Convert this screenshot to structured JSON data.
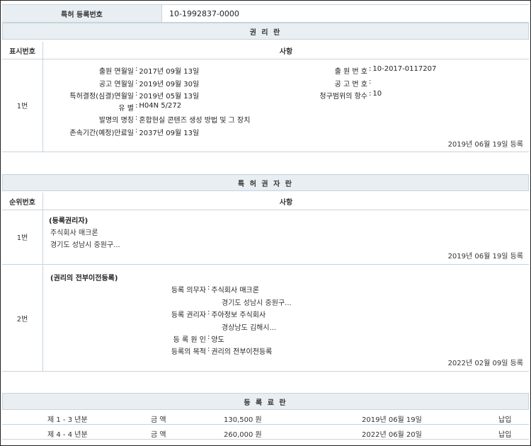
{
  "registration": {
    "label": "특허 등록번호",
    "value": "10-1992837-0000"
  },
  "rights": {
    "title": "권 리 란",
    "col_num": "표시번호",
    "col_detail": "사항",
    "row": {
      "num": "1번",
      "left": [
        {
          "k": "출원 연월일",
          "v": "2017년 09월 13일"
        },
        {
          "k": "공고 연월일",
          "v": "2019년 09월 30일"
        },
        {
          "k": "특허결정(심결)연월일",
          "v": "2019년 05월 13일"
        },
        {
          "k": "유 별",
          "v": "H04N 5/272"
        },
        {
          "k": "발명의 명칭",
          "v": "혼합현실 콘텐즈 생성 방법 및 그 장치"
        },
        {
          "k": "존속기간(예정)만료일",
          "v": "2037년 09월 13일"
        }
      ],
      "right": [
        {
          "k": "출 원 번 호",
          "v": "10-2017-0117207"
        },
        {
          "k": "공 고 번 호",
          "v": ""
        },
        {
          "k": "청구범위의 항수",
          "v": "10"
        }
      ],
      "reg_date": "2019년 06월 19일 등록"
    }
  },
  "patentee": {
    "title": "특 허 권 자 란",
    "col_num": "순위번호",
    "col_detail": "사항",
    "row1": {
      "num": "1번",
      "heading": "(등록권리자)",
      "name": "주식회사 매크론",
      "address": "경기도 성남시 중원구...",
      "reg_date": "2019년 06월 19일 등록"
    },
    "row2": {
      "num": "2번",
      "heading": "(권리의 전부이전등록)",
      "items": [
        {
          "k": "등록 의무자",
          "v": "주식회사 매크론",
          "sub": "경기도 성남시 중원구..."
        },
        {
          "k": "등록 권리자",
          "v": "주아정보 주식회사",
          "sub": "경상남도 김해시..."
        },
        {
          "k": "등 록 원 인",
          "v": "양도",
          "sub": ""
        },
        {
          "k": "등록의 목적",
          "v": "권리의 전부이전등록",
          "sub": ""
        }
      ],
      "reg_date": "2022년 02월 09일 등록"
    }
  },
  "fees": {
    "title": "등 록 료 란",
    "rows": [
      {
        "period": "제 1 - 3 년분",
        "label": "금 액",
        "amount": "130,500 원",
        "date": "2019년 06월 19일",
        "status": "납입"
      },
      {
        "period": "제 4 - 4 년분",
        "label": "금 액",
        "amount": "260,000 원",
        "date": "2022년 06월 20일",
        "status": "납입"
      }
    ]
  }
}
